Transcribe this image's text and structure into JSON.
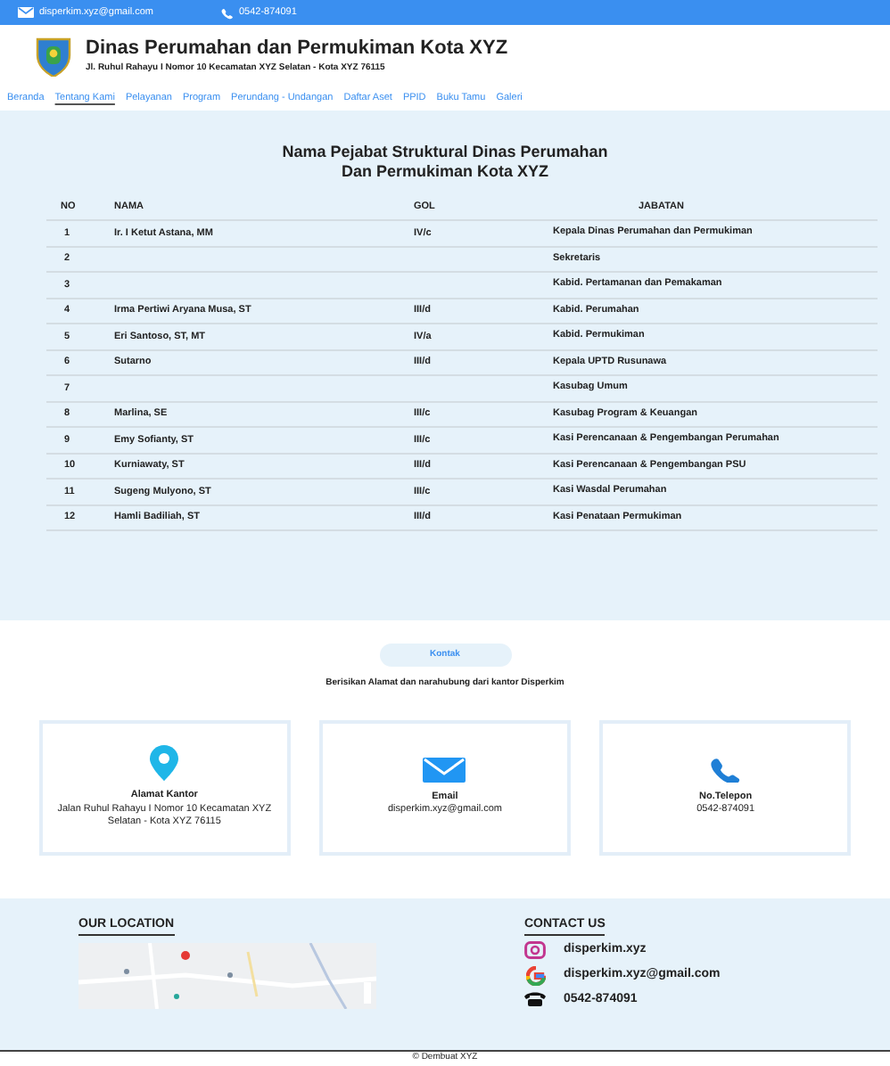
{
  "top_bar": {
    "email": "disperkim.xyz@gmail.com",
    "phone": "0542-874091"
  },
  "header": {
    "title": "Dinas Perumahan dan Permukiman Kota XYZ",
    "address": "Jl. Ruhul Rahayu I Nomor 10 Kecamatan XYZ Selatan - Kota XYZ 76115"
  },
  "nav": [
    {
      "label": "Beranda",
      "selected": false
    },
    {
      "label": "Tentang Kami",
      "selected": true
    },
    {
      "label": "Pelayanan",
      "selected": false
    },
    {
      "label": "Program",
      "selected": false
    },
    {
      "label": "Perundang - Undangan",
      "selected": false
    },
    {
      "label": "Daftar Aset",
      "selected": false
    },
    {
      "label": "PPID",
      "selected": false
    },
    {
      "label": "Buku Tamu",
      "selected": false
    },
    {
      "label": "Galeri",
      "selected": false
    }
  ],
  "officials": {
    "title": "Nama Pejabat Struktural Dinas Perumahan",
    "title_line2": "Dan Permukiman Kota XYZ",
    "columns": [
      "NO",
      "NAMA",
      "GOL",
      "JABATAN"
    ],
    "rows": [
      {
        "no": "1",
        "nama": "Ir. I Ketut Astana, MM",
        "gol": "IV/c",
        "jabatan": "Kepala Dinas Perumahan dan Permukiman"
      },
      {
        "no": "2",
        "jabatan": "Sekretaris"
      },
      {
        "no": "3",
        "jabatan": "Kabid. Pertamanan dan Pemakaman"
      },
      {
        "no": "4",
        "nama": "Irma Pertiwi Aryana Musa, ST",
        "gol": "III/d",
        "jabatan": "Kabid. Perumahan"
      },
      {
        "no": "5",
        "nama": "Eri Santoso, ST, MT",
        "gol": "IV/a",
        "jabatan": "Kabid. Permukiman"
      },
      {
        "no": "6",
        "nama": "Sutarno",
        "gol": "III/d",
        "jabatan": "Kepala UPTD Rusunawa"
      },
      {
        "no": "7",
        "jabatan": "Kasubag Umum"
      },
      {
        "no": "8",
        "nama": "Marlina, SE",
        "gol": "III/c",
        "jabatan": "Kasubag Program & Keuangan"
      },
      {
        "no": "9",
        "nama": "Emy Sofianty, ST",
        "gol": "III/c",
        "jabatan": "Kasi Perencanaan & Pengembangan Perumahan"
      },
      {
        "no": "10",
        "nama": "Kurniawaty, ST",
        "gol": "III/d",
        "jabatan": "Kasi Perencanaan & Pengembangan PSU"
      },
      {
        "no": "11",
        "nama": "Sugeng Mulyono, ST",
        "gol": "III/c",
        "jabatan": "Kasi Wasdal Perumahan"
      },
      {
        "no": "12",
        "nama": "Hamli Badiliah, ST",
        "gol": "III/d",
        "jabatan": "Kasi Penataan Permukiman"
      }
    ]
  },
  "contact": {
    "button": "Kontak",
    "subtitle": "Berisikan Alamat dan narahubung dari kantor Disperkim",
    "cards": [
      {
        "kind": "location",
        "title": "Alamat Kantor",
        "text": "Jalan Ruhul Rahayu I Nomor 10 Kecamatan XYZ Selatan - Kota XYZ 76115"
      },
      {
        "kind": "email",
        "title": "Email",
        "text": "disperkim.xyz@gmail.com"
      },
      {
        "kind": "phone",
        "title": "No.Telepon",
        "text": "0542-874091"
      }
    ]
  },
  "footer": {
    "location_title": "OUR LOCATION",
    "contact_title": "CONTACT US",
    "contacts": [
      {
        "kind": "instagram",
        "text": "disperkim.xyz"
      },
      {
        "kind": "google",
        "text": "disperkim.xyz@gmail.com"
      },
      {
        "kind": "phone",
        "text": "0542-874091"
      }
    ],
    "copyright": "© Dembuat XYZ"
  }
}
